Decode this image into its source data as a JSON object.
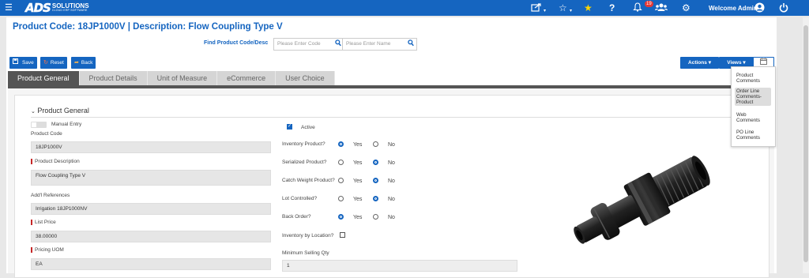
{
  "topbar": {
    "logo_main": "ADS",
    "logo_sub": "SOLUTIONS",
    "logo_tagline": "CLOUD ERP SOFTWARE",
    "notification_count": "19",
    "welcome": "Welcome Admin"
  },
  "header": {
    "title": "Product Code: 18JP1000V | Description: Flow Coupling Type V",
    "find_label": "Find Product Code/Desc",
    "code_placeholder": "Please Enter Code",
    "name_placeholder": "Please Enter Name"
  },
  "toolbar": {
    "save": "Save",
    "reset": "Reset",
    "back": "Back",
    "actions": "Actions",
    "views": "Views"
  },
  "tabs": [
    "Product General",
    "Product Details",
    "Unit of Measure",
    "eCommerce",
    "User Choice"
  ],
  "section": {
    "title": "Product General"
  },
  "form": {
    "manual_entry": "Manual Entry",
    "product_code_label": "Product Code",
    "product_code": "18JP1000V",
    "description_label": "Product Description",
    "description": "Flow Coupling Type V",
    "refs_label": "Add'l References",
    "refs": "Irrigation 18JP1000NV",
    "list_price_label": "List Price",
    "list_price": "38.00000",
    "pricing_uom_label": "Pricing UOM",
    "pricing_uom": "EA",
    "active": "Active",
    "inventory_product": "Inventory Product?",
    "serialized_product": "Serialized Product?",
    "catch_weight": "Catch Weight Product?",
    "lot_controlled": "Lot Controlled?",
    "back_order": "Back Order?",
    "inv_by_location": "Inventory by Location?",
    "min_selling_qty_label": "Minimum Selling Qty",
    "min_selling_qty": "1",
    "yes": "Yes",
    "no": "No"
  },
  "views_menu": {
    "items": [
      "Product Comments",
      "Order Line Comments-Product",
      "Web Comments",
      "PO Line Comments"
    ]
  },
  "colors": {
    "brand": "#1565c0",
    "required": "#c62828"
  }
}
